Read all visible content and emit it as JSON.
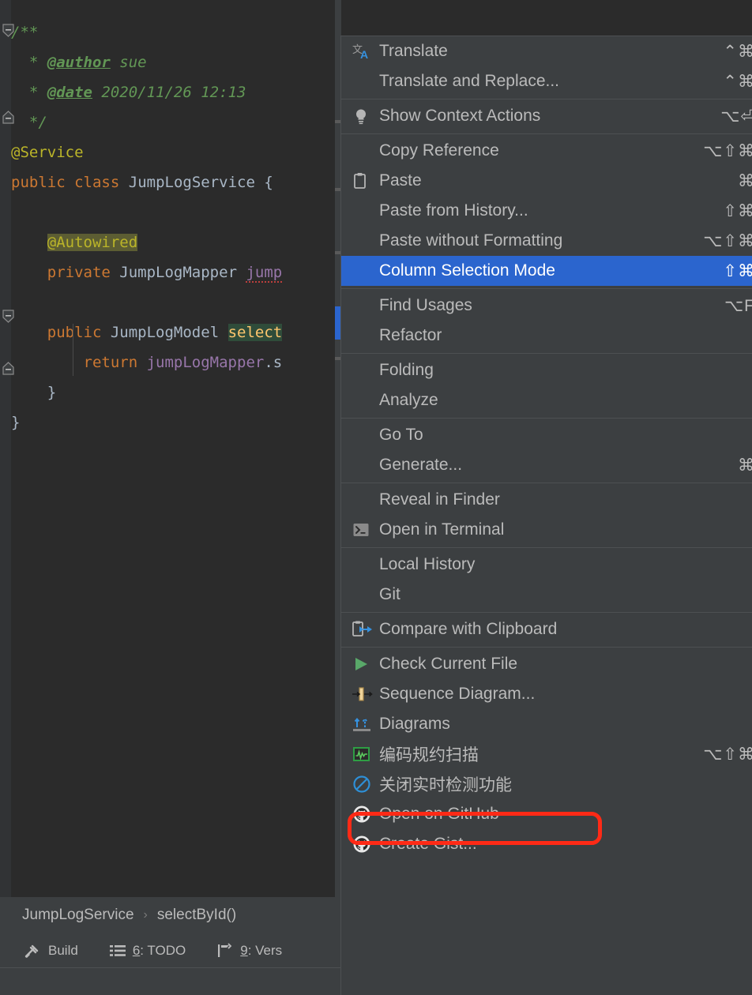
{
  "app": {
    "theme_bg": "#2B2B2B",
    "menu_bg": "#3C3F41",
    "accent_selected": "#2B65CE",
    "annotation_color": "#FF2A16"
  },
  "editor": {
    "code_lines": [
      {
        "tokens": [
          {
            "t": "/**",
            "c": "cmt"
          }
        ]
      },
      {
        "tokens": [
          {
            "t": "  * ",
            "c": "cmt"
          },
          {
            "t": "@author",
            "c": "tag"
          },
          {
            "t": " sue",
            "c": "cmt"
          }
        ]
      },
      {
        "tokens": [
          {
            "t": "  * ",
            "c": "cmt"
          },
          {
            "t": "@date",
            "c": "tag"
          },
          {
            "t": " 2020/11/26 12:13",
            "c": "cmt"
          }
        ]
      },
      {
        "tokens": [
          {
            "t": "  */",
            "c": "cmt"
          }
        ]
      },
      {
        "tokens": [
          {
            "t": "@Service",
            "c": "ann"
          }
        ]
      },
      {
        "tokens": [
          {
            "t": "public",
            "c": "kw"
          },
          {
            "t": " ",
            "c": "typ"
          },
          {
            "t": "class",
            "c": "kw"
          },
          {
            "t": " ",
            "c": "typ"
          },
          {
            "t": "JumpLogService",
            "c": "cls"
          },
          {
            "t": " {",
            "c": "br"
          }
        ]
      },
      {
        "tokens": [
          {
            "t": "",
            "c": "typ"
          }
        ]
      },
      {
        "tokens": [
          {
            "t": "    ",
            "c": "typ"
          },
          {
            "t": "@Autowired",
            "c": "annhl"
          }
        ]
      },
      {
        "tokens": [
          {
            "t": "    ",
            "c": "typ"
          },
          {
            "t": "private",
            "c": "kw"
          },
          {
            "t": " ",
            "c": "typ"
          },
          {
            "t": "JumpLogMapper",
            "c": "cls"
          },
          {
            "t": " ",
            "c": "typ"
          },
          {
            "t": "jump",
            "c": "fld squig"
          }
        ]
      },
      {
        "tokens": [
          {
            "t": "",
            "c": "typ"
          }
        ]
      },
      {
        "tokens": [
          {
            "t": "    ",
            "c": "typ"
          },
          {
            "t": "public",
            "c": "kw"
          },
          {
            "t": " ",
            "c": "typ"
          },
          {
            "t": "JumpLogModel",
            "c": "cls"
          },
          {
            "t": " ",
            "c": "typ"
          },
          {
            "t": "select",
            "c": "mthsel"
          }
        ]
      },
      {
        "tokens": [
          {
            "t": "        ",
            "c": "typ"
          },
          {
            "t": "return",
            "c": "kw"
          },
          {
            "t": " ",
            "c": "typ"
          },
          {
            "t": "jumpLogMapper",
            "c": "fld"
          },
          {
            "t": ".s",
            "c": "typ"
          }
        ]
      },
      {
        "tokens": [
          {
            "t": "    }",
            "c": "br"
          }
        ]
      },
      {
        "tokens": [
          {
            "t": "}",
            "c": "br"
          }
        ]
      }
    ]
  },
  "breadcrumb": {
    "class_name": "JumpLogService",
    "separator": "›",
    "method_name": "selectById()"
  },
  "statusbar": {
    "items": [
      {
        "icon": "hammer-icon",
        "label": "Build",
        "num": ""
      },
      {
        "icon": "list-icon",
        "label": ": TODO",
        "num": "6"
      },
      {
        "icon": "branch-icon",
        "label": ": Vers",
        "num": "9"
      }
    ]
  },
  "context_menu": {
    "groups": [
      {
        "items": [
          {
            "icon": "translate-icon",
            "label": "Translate",
            "accel": "⌃⌘"
          },
          {
            "icon": "",
            "label": "Translate and Replace...",
            "accel": "⌃⌘"
          }
        ]
      },
      {
        "items": [
          {
            "icon": "lightbulb-icon",
            "label": "Show Context Actions",
            "accel": "⌥⏎"
          }
        ]
      },
      {
        "items": [
          {
            "icon": "",
            "label": "Copy Reference",
            "accel": "⌥⇧⌘"
          },
          {
            "icon": "clipboard-icon",
            "label": "Paste",
            "accel": "⌘"
          },
          {
            "icon": "",
            "label": "Paste from History...",
            "accel": "⇧⌘"
          },
          {
            "icon": "",
            "label": "Paste without Formatting",
            "accel": "⌥⇧⌘"
          },
          {
            "icon": "",
            "label": "Column Selection Mode",
            "accel": "⇧⌘",
            "selected": true
          }
        ]
      },
      {
        "items": [
          {
            "icon": "",
            "label": "Find Usages",
            "accel": "⌥F"
          },
          {
            "icon": "",
            "label": "Refactor",
            "accel": ""
          }
        ]
      },
      {
        "items": [
          {
            "icon": "",
            "label": "Folding",
            "accel": ""
          },
          {
            "icon": "",
            "label": "Analyze",
            "accel": ""
          }
        ]
      },
      {
        "items": [
          {
            "icon": "",
            "label": "Go To",
            "accel": ""
          },
          {
            "icon": "",
            "label": "Generate...",
            "accel": "⌘"
          }
        ]
      },
      {
        "items": [
          {
            "icon": "",
            "label": "Reveal in Finder",
            "accel": ""
          },
          {
            "icon": "terminal-icon",
            "label": "Open in Terminal",
            "accel": ""
          }
        ]
      },
      {
        "items": [
          {
            "icon": "",
            "label": "Local History",
            "accel": ""
          },
          {
            "icon": "",
            "label": "Git",
            "accel": ""
          }
        ]
      },
      {
        "items": [
          {
            "icon": "compare-clipboard-icon",
            "label": "Compare with Clipboard",
            "accel": ""
          }
        ]
      },
      {
        "items": [
          {
            "icon": "play-icon",
            "label": "Check Current File",
            "accel": ""
          },
          {
            "icon": "sequence-diagram-icon",
            "label": "Sequence Diagram...",
            "accel": "",
            "annotated": true
          },
          {
            "icon": "diagrams-icon",
            "label": "Diagrams",
            "accel": ""
          },
          {
            "icon": "code-scan-icon",
            "label": "编码规约扫描",
            "accel": "⌥⇧⌘"
          },
          {
            "icon": "disable-icon",
            "label": "关闭实时检测功能",
            "accel": ""
          },
          {
            "icon": "github-icon",
            "label": "Open on GitHub",
            "accel": ""
          },
          {
            "icon": "github-icon",
            "label": "Create Gist...",
            "accel": ""
          }
        ]
      }
    ]
  }
}
